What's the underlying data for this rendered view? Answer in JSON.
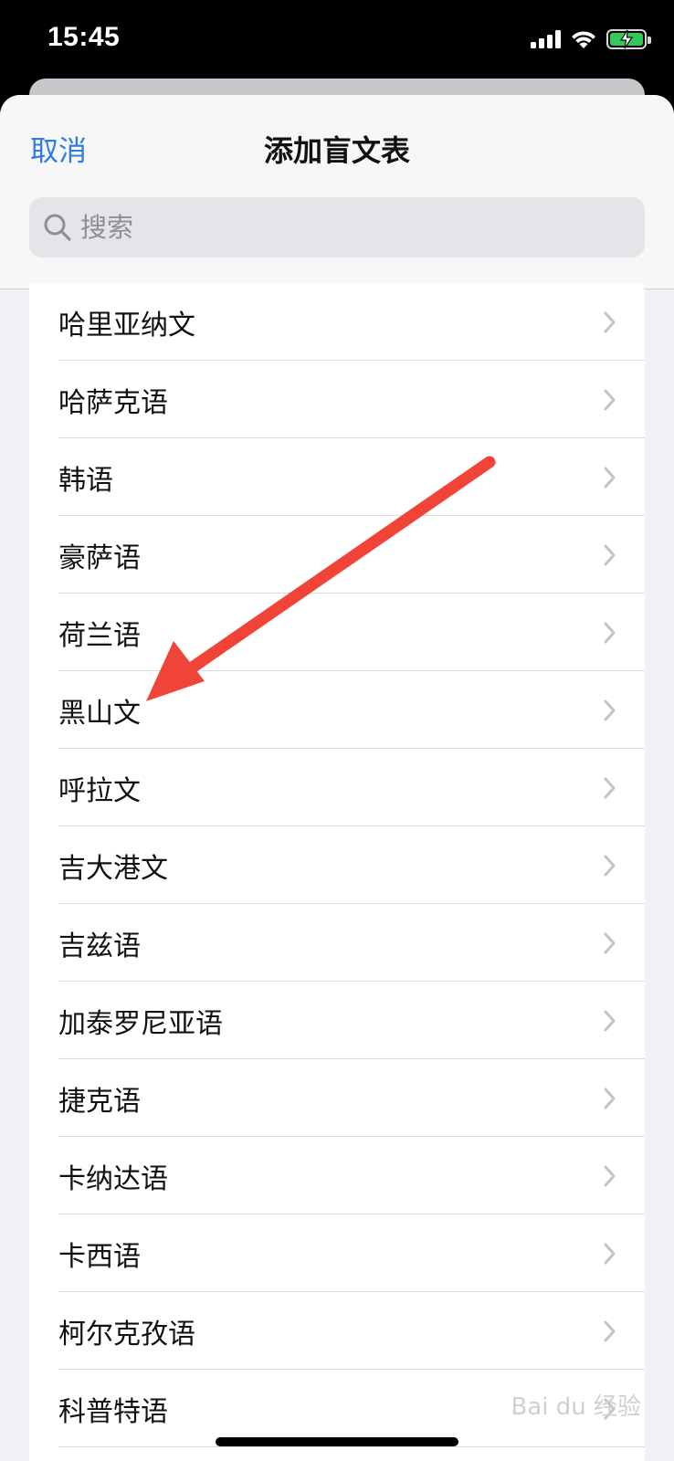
{
  "status_bar": {
    "time": "15:45"
  },
  "sheet": {
    "cancel_label": "取消",
    "title": "添加盲文表",
    "search_placeholder": "搜索"
  },
  "list": {
    "items": [
      {
        "label": "哈里亚纳文"
      },
      {
        "label": "哈萨克语"
      },
      {
        "label": "韩语"
      },
      {
        "label": "豪萨语"
      },
      {
        "label": "荷兰语"
      },
      {
        "label": "黑山文"
      },
      {
        "label": "呼拉文"
      },
      {
        "label": "吉大港文"
      },
      {
        "label": "吉兹语"
      },
      {
        "label": "加泰罗尼亚语"
      },
      {
        "label": "捷克语"
      },
      {
        "label": "卡纳达语"
      },
      {
        "label": "卡西语"
      },
      {
        "label": "柯尔克孜语"
      },
      {
        "label": "科普特语"
      }
    ]
  },
  "watermark": "Bai du 经验",
  "colors": {
    "accent": "#2f7de1",
    "annotation_arrow": "#f04438",
    "battery": "#34c759"
  }
}
